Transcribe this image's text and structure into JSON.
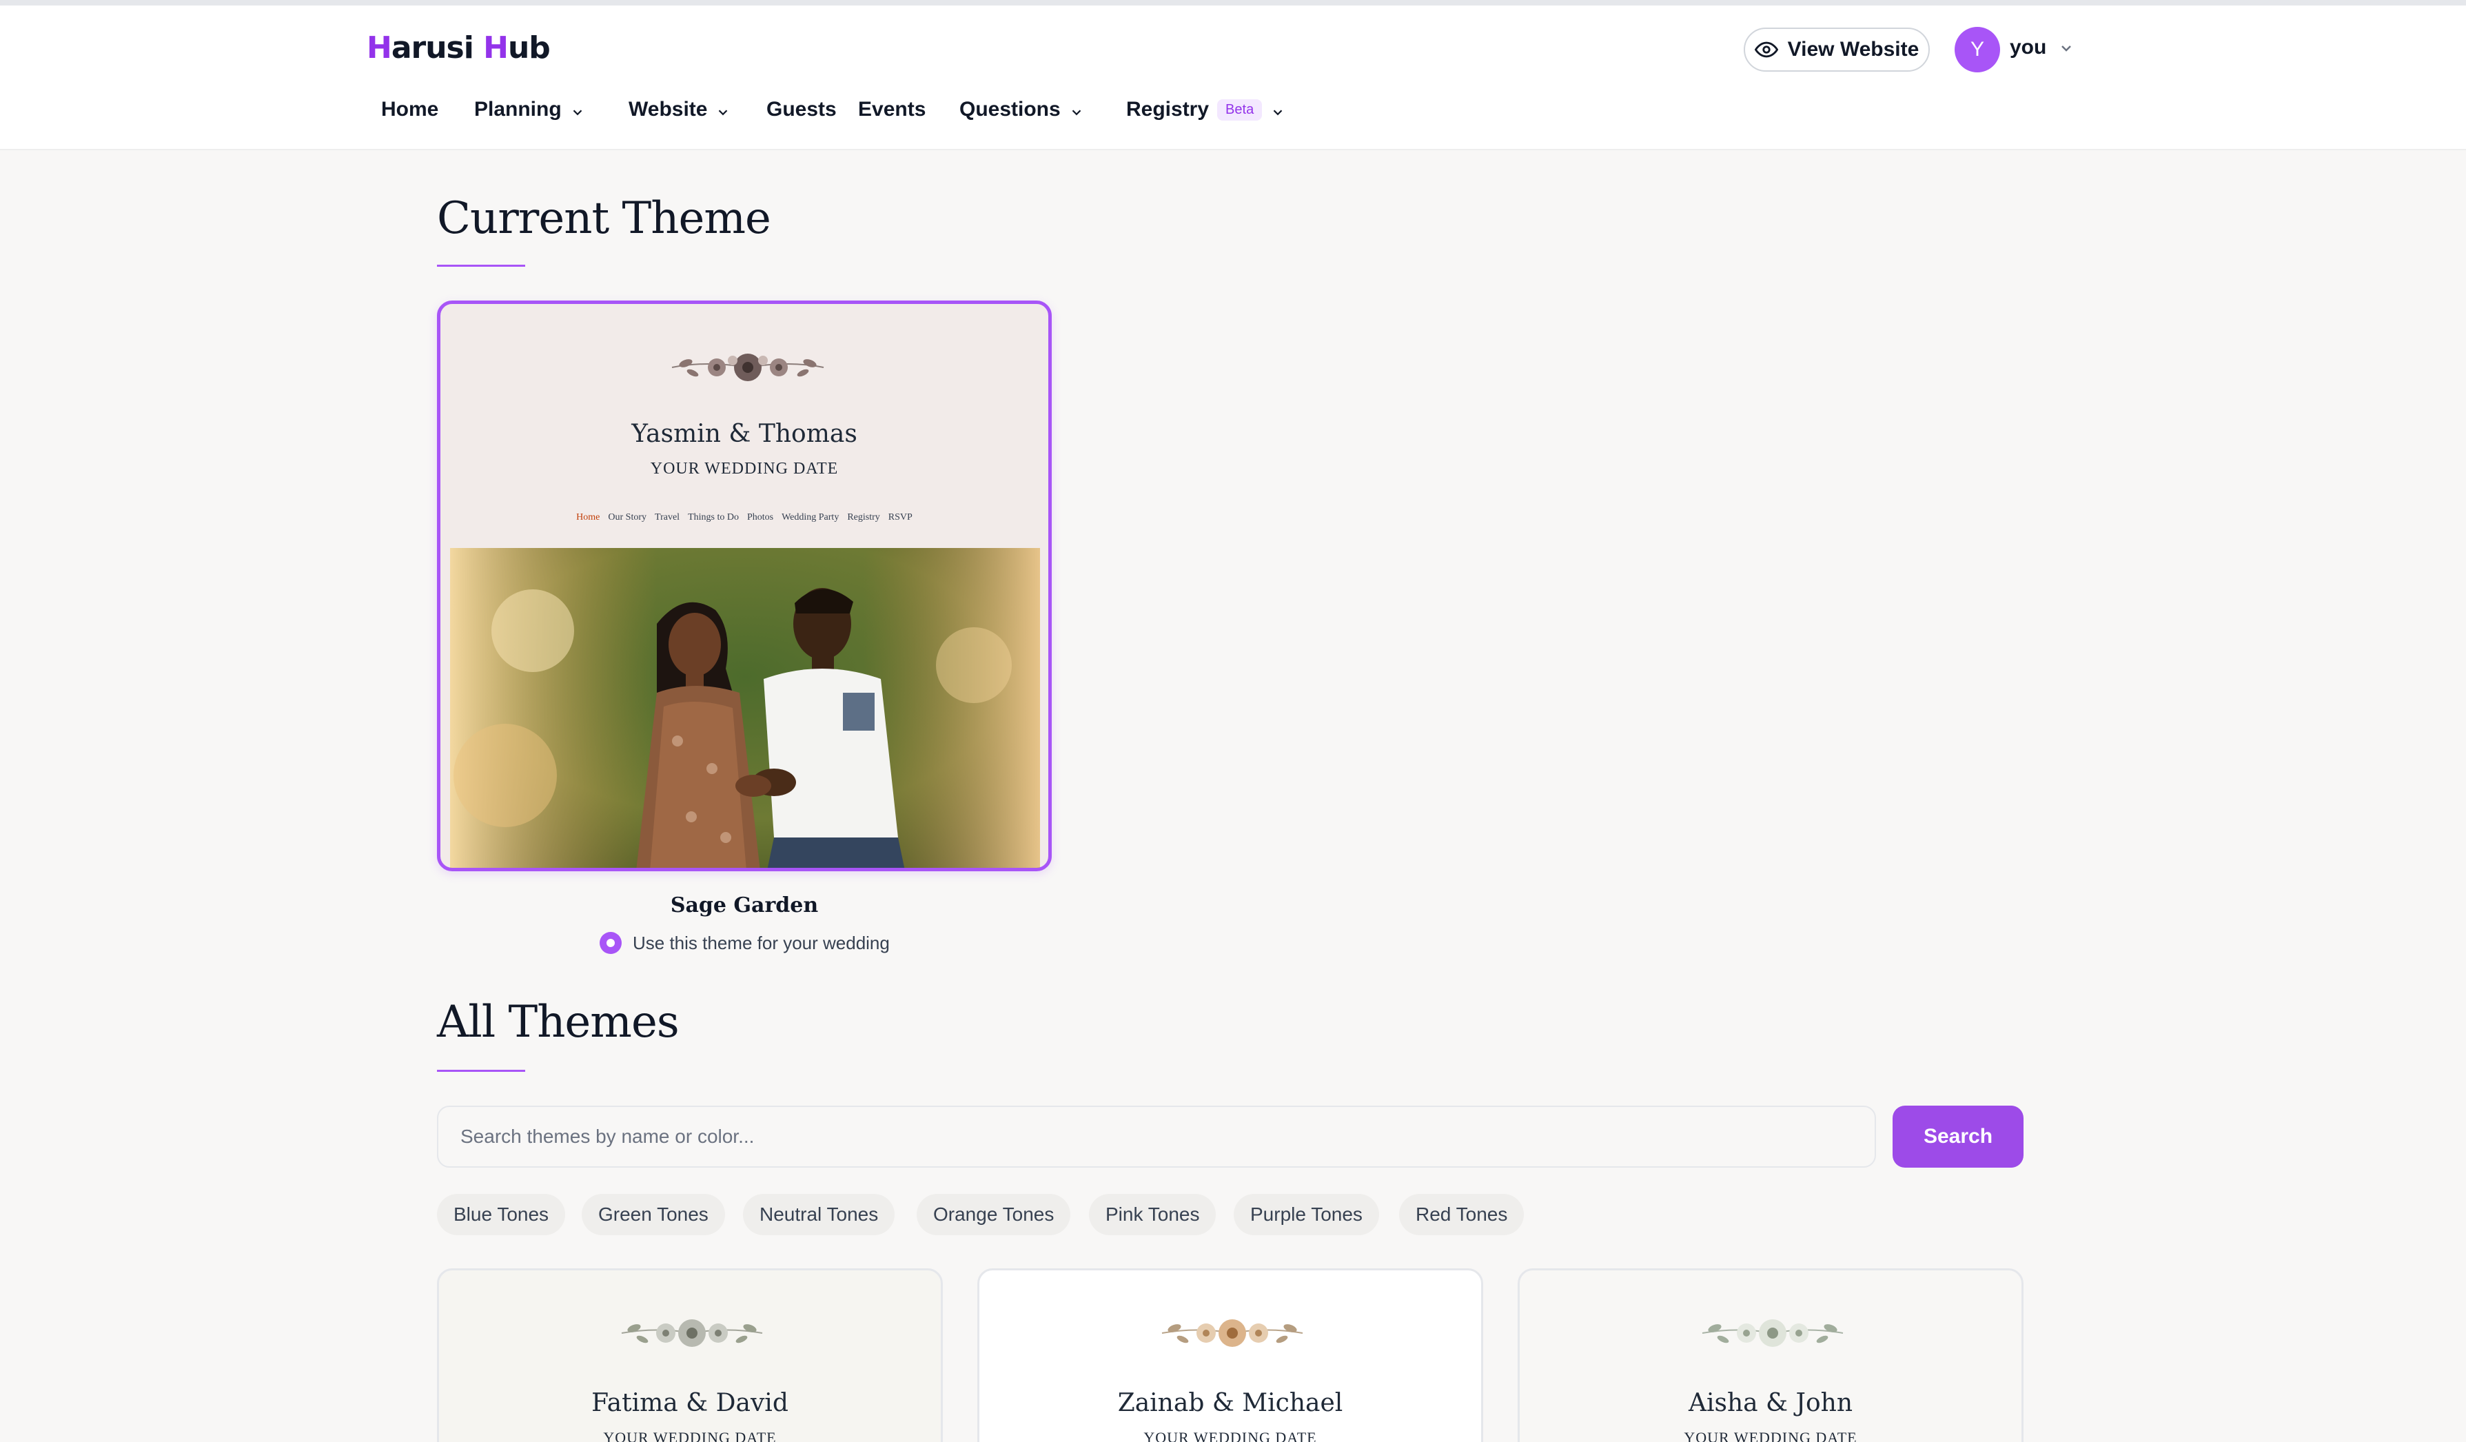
{
  "app": {
    "logo_text_a": "H",
    "logo_text_b": "arusi ",
    "logo_text_c": "H",
    "logo_text_d": "ub",
    "brand_color": "#a855f7"
  },
  "header": {
    "view_website_label": "View Website",
    "avatar_initial": "Y",
    "user_name": "you"
  },
  "nav": {
    "items": [
      {
        "label": "Home",
        "dropdown": false
      },
      {
        "label": "Planning",
        "dropdown": true
      },
      {
        "label": "Website",
        "dropdown": true
      },
      {
        "label": "Guests",
        "dropdown": false
      },
      {
        "label": "Events",
        "dropdown": false
      },
      {
        "label": "Questions",
        "dropdown": true
      },
      {
        "label": "Registry",
        "dropdown": true,
        "badge": "Beta"
      }
    ]
  },
  "current_theme": {
    "heading": "Current Theme",
    "preview": {
      "couple": "Yasmin & Thomas",
      "date": "YOUR WEDDING DATE",
      "nav": [
        "Home",
        "Our Story",
        "Travel",
        "Things to Do",
        "Photos",
        "Wedding Party",
        "Registry",
        "RSVP"
      ]
    },
    "theme_name": "Sage Garden",
    "radio_label": "Use this theme for your wedding",
    "selected": true
  },
  "all_themes": {
    "heading": "All Themes",
    "search_placeholder": "Search themes by name or color...",
    "search_value": "",
    "search_button": "Search",
    "filters": [
      "Blue Tones",
      "Green Tones",
      "Neutral Tones",
      "Orange Tones",
      "Pink Tones",
      "Purple Tones",
      "Red Tones"
    ],
    "cards": [
      {
        "couple": "Fatima & David",
        "date": "YOUR WEDDING DATE",
        "bg": "#f6f5f1"
      },
      {
        "couple": "Zainab & Michael",
        "date": "YOUR WEDDING DATE",
        "bg": "#ffffff"
      },
      {
        "couple": "Aisha & John",
        "date": "YOUR WEDDING DATE",
        "bg": "#f8f7f5"
      }
    ]
  }
}
